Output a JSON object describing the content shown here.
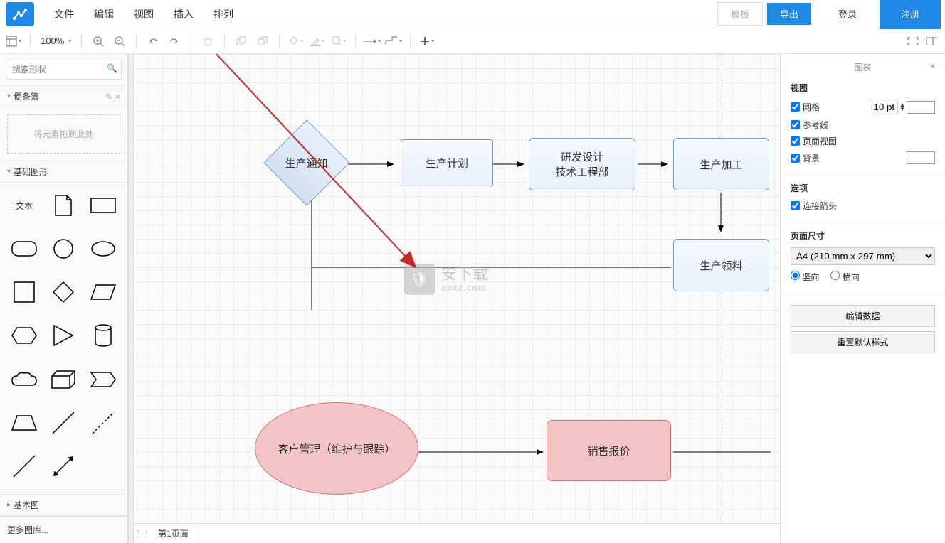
{
  "menu": {
    "file": "文件",
    "edit": "编辑",
    "view": "视图",
    "insert": "插入",
    "arrange": "排列"
  },
  "header": {
    "template": "模板",
    "export": "导出",
    "login": "登录",
    "register": "注册"
  },
  "toolbar": {
    "zoom": "100%"
  },
  "leftPanel": {
    "search_placeholder": "搜索形状",
    "scratch_head": "便条簿",
    "dropzone": "将元素拖到此处",
    "basic_shapes_head": "基础图形",
    "text_label": "文本",
    "basic_diagram_head": "基本图",
    "more_shapes": "更多图库..."
  },
  "canvas": {
    "nodes": {
      "notice": "生产通知",
      "plan": "生产计划",
      "rd": "研发设计\n技术工程部",
      "process": "生产加工",
      "pick": "生产领料",
      "cust": "客户管理（维护与跟踪）",
      "quote": "销售报价"
    },
    "watermark_cn": "安下载",
    "watermark_en": "anxz.com",
    "tab1": "第1页面"
  },
  "rightPanel": {
    "title": "图表",
    "view_head": "视图",
    "grid": "网格",
    "grid_size": "10 pt",
    "guides": "参考线",
    "page_view": "页面视图",
    "background": "背景",
    "options_head": "选项",
    "connect_arrows": "连接箭头",
    "page_size_head": "页面尺寸",
    "page_size_value": "A4 (210 mm x 297 mm)",
    "portrait": "竖向",
    "landscape": "横向",
    "edit_data": "编辑数据",
    "reset_style": "重置默认样式"
  }
}
